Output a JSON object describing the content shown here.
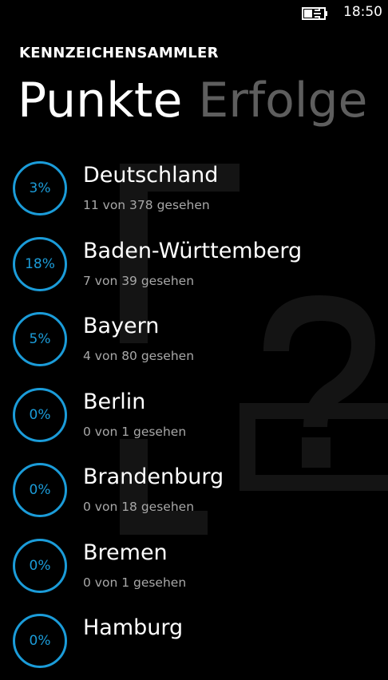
{
  "status_bar": {
    "time": "18:50",
    "battery_icon": "battery-charging-icon"
  },
  "app": {
    "title": "KENNZEICHENSAMMLER"
  },
  "pivot": {
    "items": [
      {
        "label": "Punkte",
        "active": true
      },
      {
        "label": "Erfolge",
        "active": false
      }
    ]
  },
  "colors": {
    "accent": "#1b9cd9",
    "background": "#000000",
    "inactive_header": "#5e5e5e",
    "subtext": "#a8a8a8"
  },
  "background_art": {
    "description_icon": "license-plate-question-icon"
  },
  "regions": [
    {
      "name": "Deutschland",
      "percent": "3%",
      "seen_text": "11 von 378 gesehen"
    },
    {
      "name": "Baden-Württemberg",
      "percent": "18%",
      "seen_text": "7 von 39 gesehen"
    },
    {
      "name": "Bayern",
      "percent": "5%",
      "seen_text": "4 von 80 gesehen"
    },
    {
      "name": "Berlin",
      "percent": "0%",
      "seen_text": "0 von 1 gesehen"
    },
    {
      "name": "Brandenburg",
      "percent": "0%",
      "seen_text": "0 von 18 gesehen"
    },
    {
      "name": "Bremen",
      "percent": "0%",
      "seen_text": "0 von 1 gesehen"
    },
    {
      "name": "Hamburg",
      "percent": "0%",
      "seen_text": ""
    }
  ]
}
